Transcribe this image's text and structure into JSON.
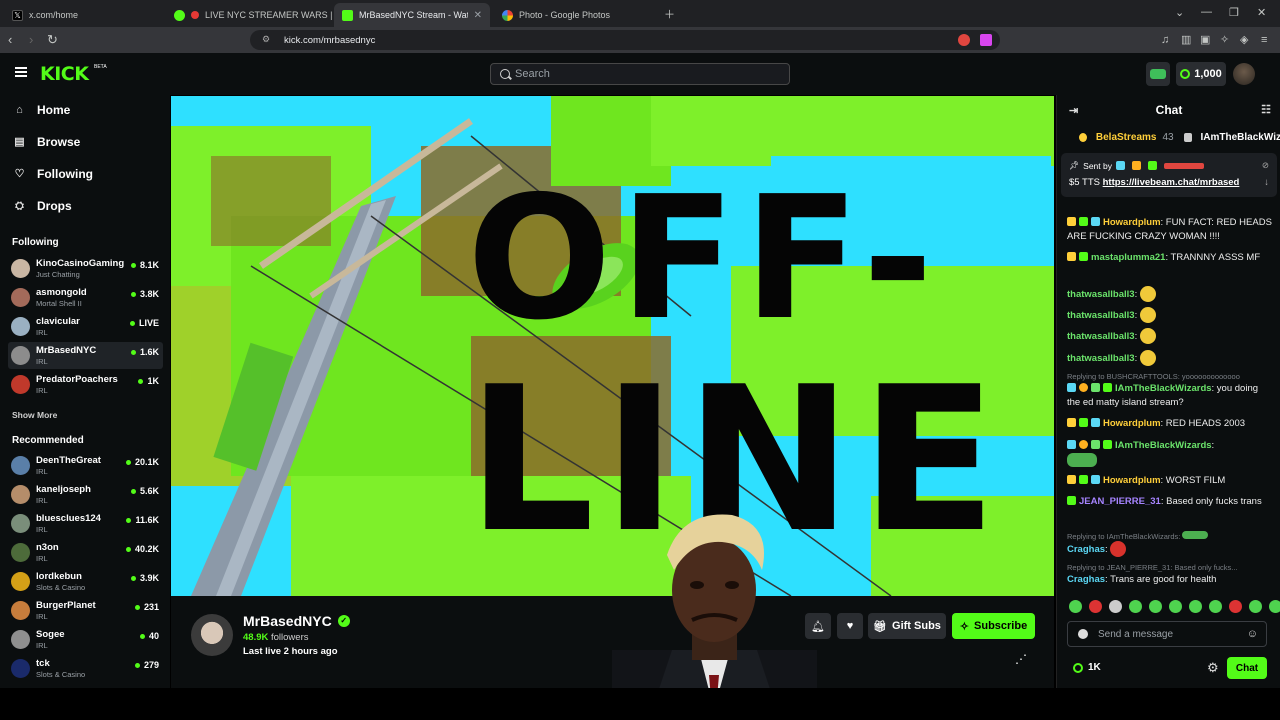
{
  "browser": {
    "tabs": [
      {
        "title": "x.com/home",
        "active": false
      },
      {
        "title": "LIVE NYC STREAMER WARS | New",
        "active": false
      },
      {
        "title": "MrBasedNYC Stream - Watch Live",
        "active": true
      },
      {
        "title": "Photo - Google Photos",
        "active": false
      }
    ],
    "url": "kick.com/mrbasednyc"
  },
  "header": {
    "logo": "KICK",
    "beta": "BETA",
    "search_placeholder": "Search",
    "coins": "1,000"
  },
  "sidebar": {
    "nav": [
      {
        "label": "Home",
        "icon": "home-icon"
      },
      {
        "label": "Browse",
        "icon": "browse-icon"
      },
      {
        "label": "Following",
        "icon": "heart-icon"
      },
      {
        "label": "Drops",
        "icon": "drops-icon"
      }
    ],
    "following_title": "Following",
    "following": [
      {
        "name": "KinoCasinoGaming",
        "category": "Just Chatting",
        "viewers": "8.1K",
        "color": "#c9b6a3"
      },
      {
        "name": "asmongold",
        "category": "Mortal Shell II",
        "viewers": "3.8K",
        "color": "#a36a5a"
      },
      {
        "name": "clavicular",
        "category": "IRL",
        "viewers": "LIVE",
        "color": "#9ab0c2"
      },
      {
        "name": "MrBasedNYC",
        "category": "IRL",
        "viewers": "1.6K",
        "color": "#8c8c8c"
      },
      {
        "name": "PredatorPoachers",
        "category": "IRL",
        "viewers": "1K",
        "color": "#c0392b"
      }
    ],
    "show_more": "Show More",
    "recommended_title": "Recommended",
    "recommended": [
      {
        "name": "DeenTheGreat",
        "category": "IRL",
        "viewers": "20.1K",
        "color": "#5a7fa8"
      },
      {
        "name": "kaneljoseph",
        "category": "IRL",
        "viewers": "5.6K",
        "color": "#b58d6a"
      },
      {
        "name": "bluesclues124",
        "category": "IRL",
        "viewers": "11.6K",
        "color": "#7a8e7a"
      },
      {
        "name": "n3on",
        "category": "IRL",
        "viewers": "40.2K",
        "color": "#4d6b3a"
      },
      {
        "name": "lordkebun",
        "category": "Slots & Casino",
        "viewers": "3.9K",
        "color": "#d4a017"
      },
      {
        "name": "BurgerPlanet",
        "category": "IRL",
        "viewers": "231",
        "color": "#c77d3c"
      },
      {
        "name": "Sogee",
        "category": "IRL",
        "viewers": "40",
        "color": "#8f8f8f"
      },
      {
        "name": "tck",
        "category": "Slots & Casino",
        "viewers": "279",
        "color": "#1a2a6a"
      }
    ]
  },
  "banner": {
    "line1": "OFF-",
    "line2": "LINE"
  },
  "channel": {
    "name": "MrBasedNYC",
    "followers_count": "48.9K",
    "followers_label": "followers",
    "last_live": "Last live 2 hours ago",
    "gift_label": "Gift Subs",
    "subscribe_label": "Subscribe"
  },
  "chat": {
    "title": "Chat",
    "gifter1": "BelaStreams",
    "gifter1_count": "43",
    "gifter2": "IAmTheBlackWiz",
    "pinned_sent_by": "Sent by",
    "pinned_amount": "$5 TTS",
    "pinned_link": "https://livebeam.chat/mrbased",
    "messages": [
      {
        "user": "Howardplum",
        "text": ": FUN FACT: RED HEADS ARE FUCKING CRAZY WOMAN !!!!"
      },
      {
        "user": "mastaplumma21",
        "text": ": TRANNNY ASSS MF"
      },
      {
        "user": "thatwasallball3",
        "text": ":"
      },
      {
        "user": "thatwasallball3",
        "text": ":"
      },
      {
        "user": "thatwasallball3",
        "text": ":"
      },
      {
        "user": "thatwasallball3",
        "text": ":"
      },
      {
        "reply": "Replying to BUSHCRAFTTOOLS: yooooooooooooo"
      },
      {
        "user": "IAmTheBlackWizards",
        "text": ": you doing the ed matty island stream?"
      },
      {
        "user": "Howardplum",
        "text": ": RED HEADS 2003"
      },
      {
        "user": "IAmTheBlackWizards",
        "text": ":"
      },
      {
        "user": "Howardplum",
        "text": ": WORST FILM"
      },
      {
        "user": "JEAN_PIERRE_31",
        "text": ": Based only fucks trans"
      },
      {
        "reply": "Replying to IAmTheBlackWizards:"
      },
      {
        "user": "Craghas",
        "text": ":"
      },
      {
        "reply": "Replying to JEAN_PIERRE_31: Based only fucks..."
      },
      {
        "user": "Craghas",
        "text": ": Trans are good for health"
      }
    ],
    "send_placeholder": "Send a message",
    "viewer_count": "1K",
    "chat_button": "Chat"
  }
}
